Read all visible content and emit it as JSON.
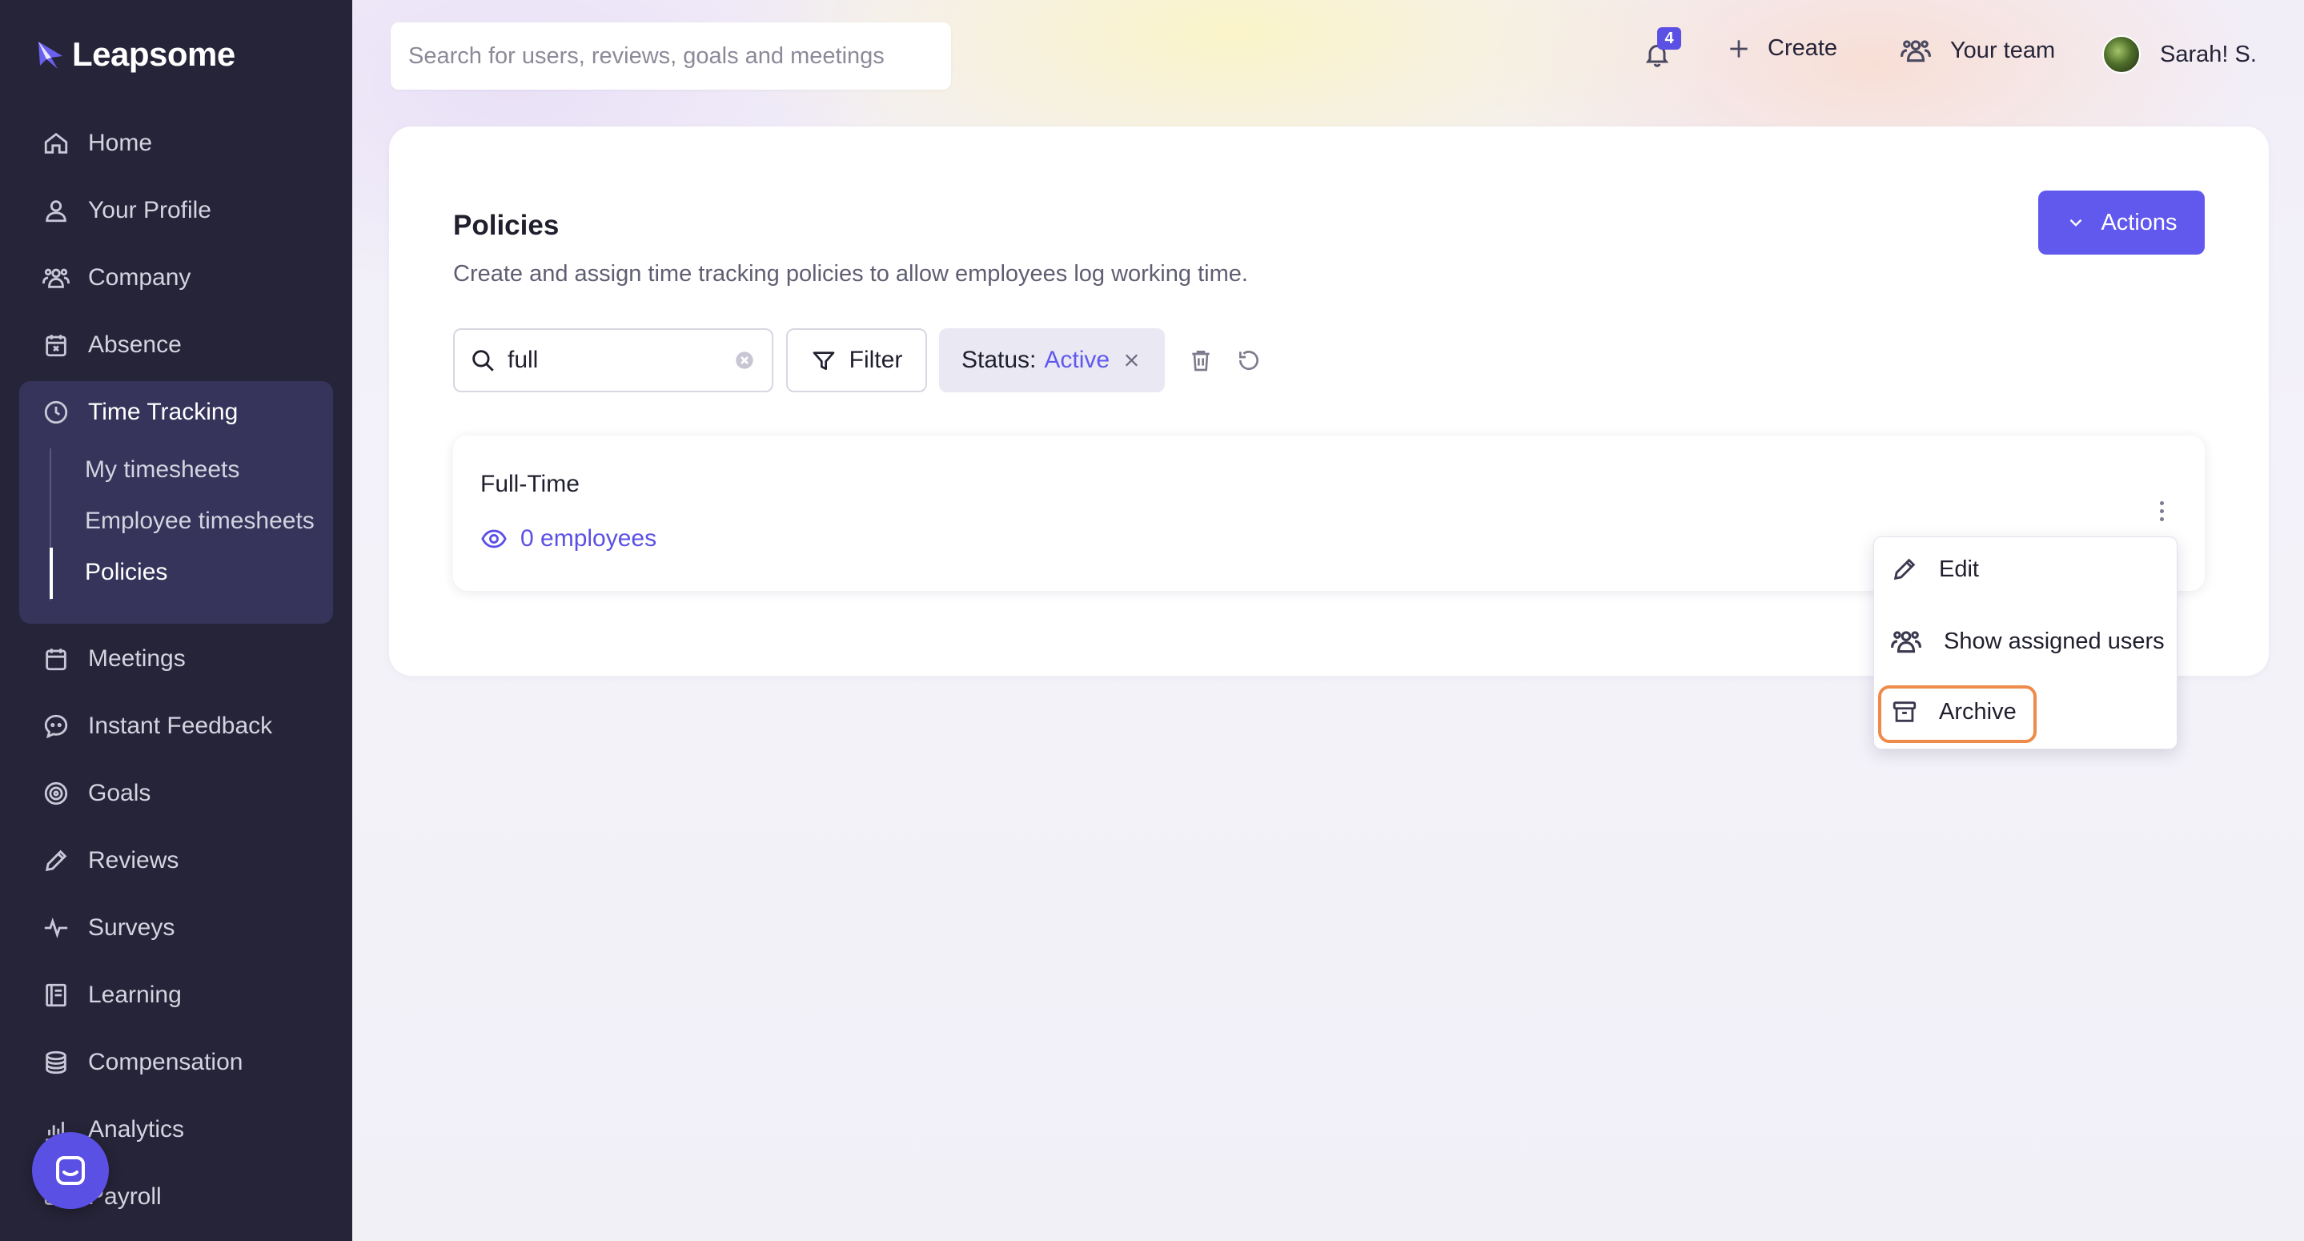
{
  "app": {
    "logo_text": "Leapsome"
  },
  "sidebar": {
    "items": [
      {
        "label": "Home",
        "icon": "home-icon"
      },
      {
        "label": "Your Profile",
        "icon": "user-icon"
      },
      {
        "label": "Company",
        "icon": "users-icon"
      },
      {
        "label": "Absence",
        "icon": "calendar-x-icon"
      },
      {
        "label": "Time Tracking",
        "icon": "clock-icon"
      },
      {
        "label": "Meetings",
        "icon": "calendar-icon"
      },
      {
        "label": "Instant Feedback",
        "icon": "chat-icon"
      },
      {
        "label": "Goals",
        "icon": "target-icon"
      },
      {
        "label": "Reviews",
        "icon": "pencil-icon"
      },
      {
        "label": "Surveys",
        "icon": "pulse-icon"
      },
      {
        "label": "Learning",
        "icon": "book-icon"
      },
      {
        "label": "Compensation",
        "icon": "coins-icon"
      },
      {
        "label": "Analytics",
        "icon": "chart-icon"
      },
      {
        "label": "Payroll",
        "icon": "payroll-icon"
      }
    ],
    "time_tracking_sub": [
      "My timesheets",
      "Employee timesheets",
      "Policies"
    ],
    "active_sub": "Policies"
  },
  "topbar": {
    "search_placeholder": "Search for users, reviews, goals and meetings",
    "notifications_count": "4",
    "create_label": "Create",
    "team_label": "Your team",
    "user_name": "Sarah! S."
  },
  "page": {
    "title": "Policies",
    "description": "Create and assign time tracking policies to allow employees log working time.",
    "actions_label": "Actions"
  },
  "filters": {
    "search_value": "full",
    "filter_label": "Filter",
    "status_key": "Status:",
    "status_value": "Active"
  },
  "policies": [
    {
      "name": "Full-Time",
      "employees": "0 employees"
    }
  ],
  "context_menu": {
    "items": [
      {
        "label": "Edit",
        "icon": "pencil-icon"
      },
      {
        "label": "Show assigned users",
        "icon": "users-icon"
      },
      {
        "label": "Archive",
        "icon": "archive-icon"
      }
    ],
    "highlighted": "Archive"
  },
  "colors": {
    "sidebar_bg": "#262438",
    "accent": "#6158ee",
    "highlight": "#ee8a4a"
  }
}
